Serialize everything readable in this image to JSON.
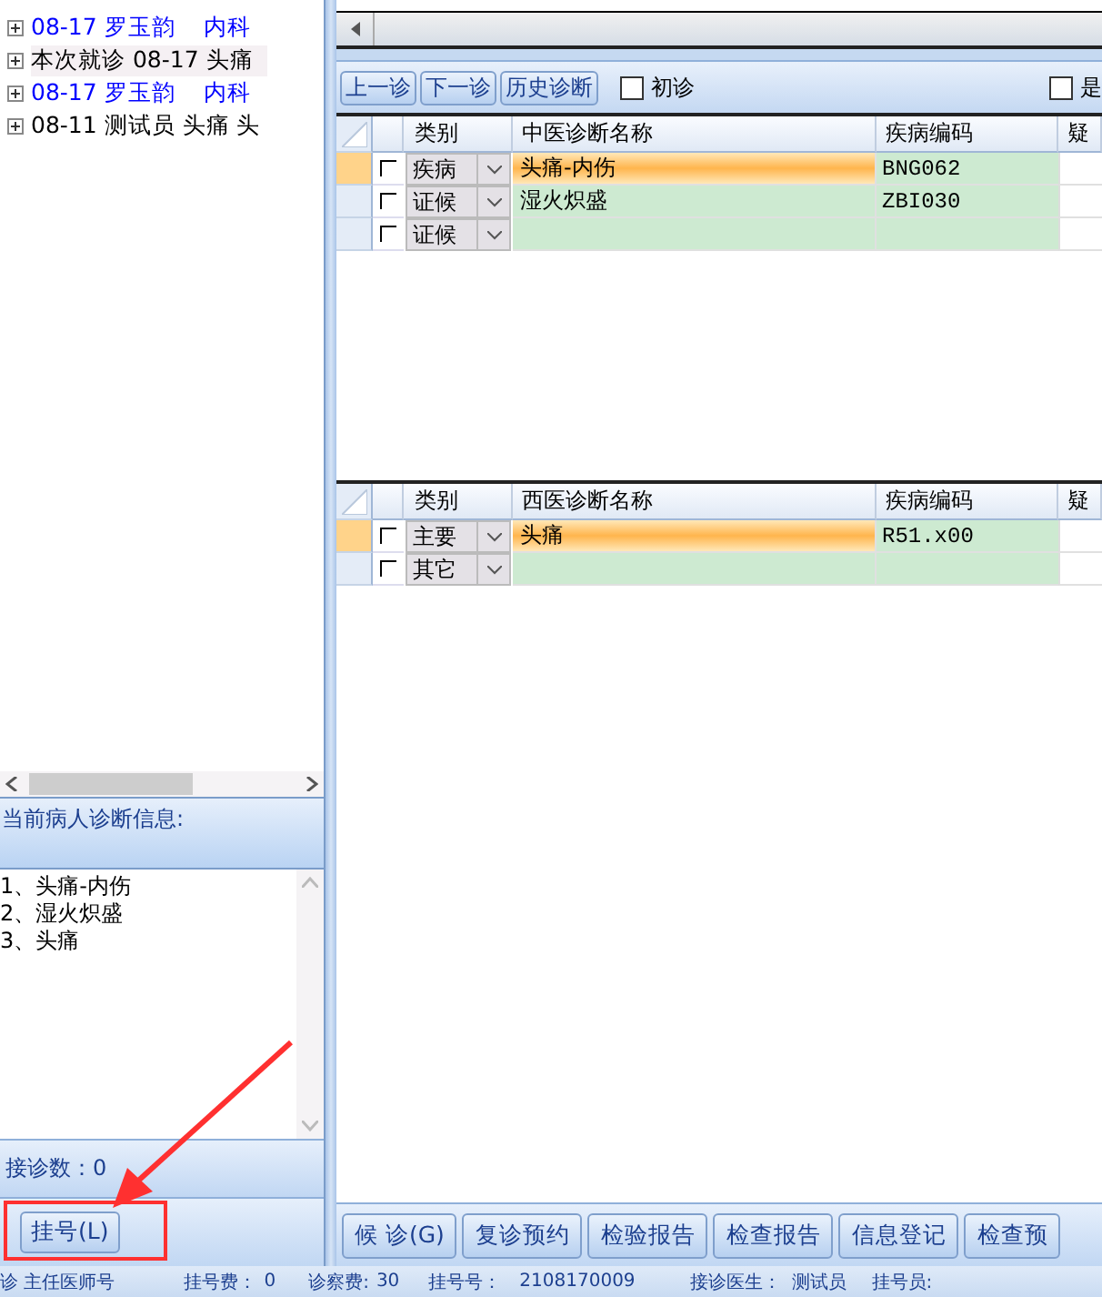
{
  "tree": {
    "items": [
      {
        "text": "08-17 罗玉韵    内科",
        "color": "#0000ff",
        "selected": false
      },
      {
        "text": "本次就诊 08-17 头痛",
        "color": "#000000",
        "selected": true
      },
      {
        "text": "08-17 罗玉韵    内科",
        "color": "#0000ff",
        "selected": false
      },
      {
        "text": "08-11 测试员 头痛 头",
        "color": "#000000",
        "selected": false
      }
    ]
  },
  "diagnosis_info": {
    "title": "当前病人诊断信息:",
    "lines": [
      "1、头痛-内伤",
      "2、湿火炽盛",
      "3、头痛"
    ]
  },
  "visit_count": "接诊数：0",
  "register_button": "挂号(L)",
  "toolbar": {
    "buttons": [
      "上一诊",
      "下一诊",
      "历史诊断"
    ],
    "checkboxes": [
      {
        "label": "初诊",
        "checked": false
      },
      {
        "label": "是",
        "checked": false
      }
    ]
  },
  "tcm_grid": {
    "columns": [
      "类别",
      "中医诊断名称",
      "疾病编码",
      "疑"
    ],
    "rows": [
      {
        "checked": false,
        "category": "疾病",
        "name": "头痛-内伤",
        "code": "BNG062",
        "selected": true
      },
      {
        "checked": false,
        "category": "证候",
        "name": "湿火炽盛",
        "code": "ZBI030",
        "selected": false
      },
      {
        "checked": false,
        "category": "证候",
        "name": "",
        "code": "",
        "selected": false
      }
    ]
  },
  "western_grid": {
    "columns": [
      "类别",
      "西医诊断名称",
      "疾病编码",
      "疑"
    ],
    "rows": [
      {
        "checked": false,
        "category": "主要",
        "name": "头痛",
        "code": "R51.x00",
        "selected": true
      },
      {
        "checked": false,
        "category": "其它",
        "name": "",
        "code": "",
        "selected": false
      }
    ]
  },
  "action_buttons": [
    "候 诊(G)",
    "复诊预约",
    "检验报告",
    "检查报告",
    "信息登记",
    "检查预"
  ],
  "status_bar": [
    "诊 主任医师号",
    "挂号费：",
    "0",
    "诊察费:",
    "30",
    "挂号号：",
    "2108170009",
    "接诊医生：",
    "测试员",
    "挂号员:"
  ]
}
